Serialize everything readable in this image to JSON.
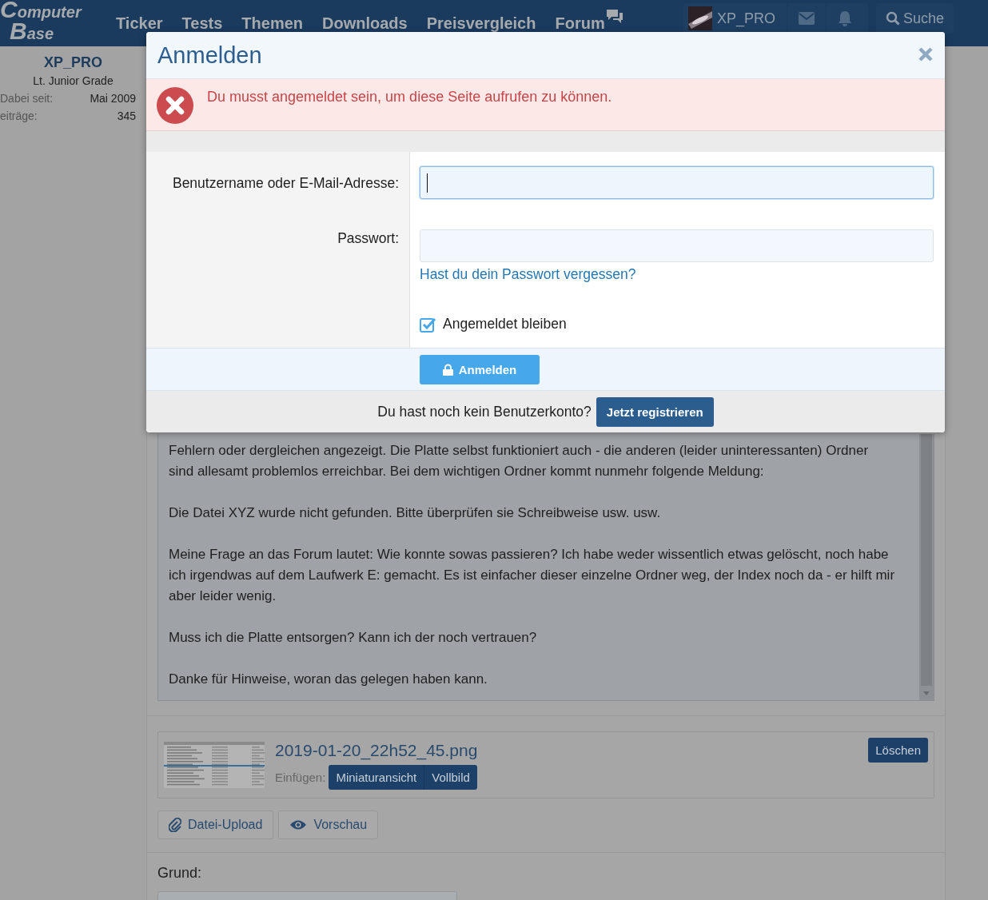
{
  "header": {
    "logo": [
      "Computer",
      "Base"
    ],
    "nav": [
      {
        "label": "Ticker",
        "kind": "text"
      },
      {
        "label": "Tests",
        "kind": "text"
      },
      {
        "label": "Themen",
        "kind": "text"
      },
      {
        "label": "Downloads",
        "kind": "text"
      },
      {
        "label": "Preisvergleich",
        "kind": "text"
      },
      {
        "label": "Forum",
        "kind": "chat"
      }
    ],
    "user": "XP_PRO",
    "search": "Suche"
  },
  "sidebar": {
    "name": "XP_PRO",
    "rank": "Lt. Junior Grade",
    "stats": [
      {
        "label": "Dabei seit:",
        "value": "Mai 2009"
      },
      {
        "label": "eiträge:",
        "value": "345"
      }
    ]
  },
  "editor": {
    "paragraphs": [
      "Fehlern oder dergleichen angezeigt. Die Platte selbst funktioniert auch - die anderen (leider uninteressanten) Ordner sind allesamt problemlos erreichbar. Bei dem wichtigen Ordner kommt nunmehr folgende Meldung:",
      "Die Datei XYZ wurde nicht gefunden. Bitte überprüfen sie Schreibweise usw. usw.",
      "Meine Frage an das Forum lautet: Wie konnte sowas passieren? Ich habe weder wissentlich etwas gelöscht, noch habe ich irgendwas auf dem Laufwerk E: gemacht. Es ist einfacher dieser einzelne Ordner weg, der Index noch da - er hilft mir aber leider wenig.",
      "Muss ich die Platte entsorgen? Kann ich der noch vertrauen?",
      "Danke für Hinweise, woran das gelegen haben kann."
    ]
  },
  "attachment": {
    "filename": "2019-01-20_22h52_45.png",
    "insert_label": "Einfügen:",
    "insert_buttons": [
      "Miniaturansicht",
      "Vollbild"
    ],
    "delete": "Löschen"
  },
  "actions": [
    {
      "label": "Datei-Upload",
      "kind": "clip"
    },
    {
      "label": "Vorschau",
      "kind": "eye"
    }
  ],
  "reason": {
    "label": "Grund:"
  },
  "modal": {
    "title": "Anmelden",
    "error": "Du musst angemeldet sein, um diese Seite aufrufen zu können.",
    "fields": [
      {
        "label": "Benutzername oder E-Mail-Adresse:",
        "focused": true
      },
      {
        "label": "Passwort:",
        "focused": false
      }
    ],
    "forgot_link": "Hast du dein Passwort vergessen?",
    "remember": {
      "label": "Angemeldet bleiben",
      "checked": true
    },
    "submit": "Anmelden",
    "footer_text": "Du hast noch kein Benutzerkonto?",
    "register": "Jetzt registrieren"
  }
}
